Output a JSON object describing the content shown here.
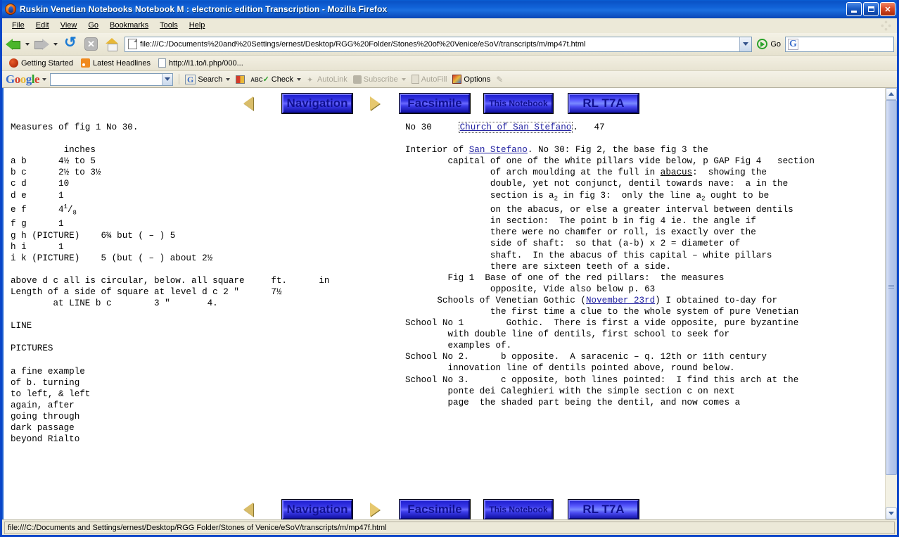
{
  "window": {
    "title": "Ruskin Venetian Notebooks Notebook M : electronic edition Transcription - Mozilla Firefox",
    "minimize_label": "Minimize",
    "maximize_label": "Maximize",
    "close_label": "Close"
  },
  "menubar": {
    "items": [
      {
        "label": "File"
      },
      {
        "label": "Edit"
      },
      {
        "label": "View"
      },
      {
        "label": "Go"
      },
      {
        "label": "Bookmarks"
      },
      {
        "label": "Tools"
      },
      {
        "label": "Help"
      }
    ]
  },
  "navtoolbar": {
    "back_label": "Back",
    "forward_label": "Forward",
    "reload_label": "Reload",
    "stop_label": "Stop",
    "stop_glyph": "✕",
    "home_label": "Home",
    "url": "file:///C:/Documents%20and%20Settings/ernest/Desktop/RGG%20Folder/Stones%20of%20Venice/eSoV/transcripts/m/mp47t.html",
    "url_placeholder": "",
    "go_label": "Go",
    "search_value": "",
    "search_placeholder": ""
  },
  "bookmarks": {
    "items": [
      {
        "label": "Getting Started",
        "icon": "firefox-icon"
      },
      {
        "label": "Latest Headlines",
        "icon": "rss-icon"
      },
      {
        "label": "http://i1.to/i.php/000...",
        "icon": "page-icon"
      }
    ]
  },
  "google_toolbar": {
    "logo": "Google",
    "search_value": "",
    "search_placeholder": "",
    "items": [
      {
        "label": "Search",
        "icon": "google-g-icon",
        "enabled": true,
        "caret": true
      },
      {
        "label": "",
        "icon": "bookmarks-icon",
        "enabled": true,
        "caret": false
      },
      {
        "label": "Check",
        "icon": "spellcheck-icon",
        "enabled": true,
        "caret": true
      },
      {
        "label": "AutoLink",
        "icon": "wand-icon",
        "enabled": false,
        "caret": false
      },
      {
        "label": "Subscribe",
        "icon": "rss-icon",
        "enabled": false,
        "caret": true
      },
      {
        "label": "AutoFill",
        "icon": "autofill-icon",
        "enabled": false,
        "caret": false
      },
      {
        "label": "Options",
        "icon": "options-icon",
        "enabled": true,
        "caret": false
      },
      {
        "label": "",
        "icon": "highlighter-icon",
        "enabled": false,
        "caret": false
      }
    ]
  },
  "page": {
    "nav": {
      "prev_arrow": "left-arrow-icon",
      "next_arrow": "right-arrow-icon",
      "navigation_label": "Navigation",
      "facsimile_label": "Facsimile",
      "notebook_label": "This Notebook",
      "rlt7a_label": "RL T7A"
    },
    "left_column": {
      "heading": "Measures of fig 1 No 30.",
      "unit_header": "          inches",
      "rows": [
        "a b      4½ to 5",
        "b c      2½ to 3½",
        "c d      10",
        "d e      1",
        "f g      1",
        "g h (PICTURE)    6¾ but ( – ) 5",
        "h i      1",
        "i k (PICTURE)    5 (but ( – ) about 2½"
      ],
      "ef_prefix": "e f      4",
      "ef_sup": "1",
      "ef_slash": "/",
      "ef_sub": "8",
      "note_lines": [
        "above d c all is circular, below. all square     ft.      in",
        "Length of a side of square at level d c 2 \"      7½",
        "        at LINE b c        3 \"       4."
      ],
      "line_heading": "LINE",
      "pictures_heading": "PICTURES",
      "caption_lines": [
        "a fine example",
        "of b. turning",
        "to left, & left",
        "again, after",
        "going through",
        "dark passage",
        "beyond Rialto"
      ]
    },
    "right_column": {
      "header_no": "No 30",
      "header_link": "Church of San Stefano",
      "header_link_part1": "Church of ",
      "header_link_part2": "San Stefano",
      "header_period": ".   47",
      "para1_pre": "Interior of ",
      "para1_link": "San Stefano",
      "para1_post": ". No 30: Fig 2, the base fig 3 the",
      "line2": "        capital of one of the white pillars vide below, p GAP Fig 4   section",
      "line3_pre": "                of arch moulding at the full in ",
      "line3_gloss": "abacus",
      "line3_post": ":  showing the",
      "line4": "                double, yet not conjunct, dentil towards nave:  a in the",
      "line5_a": "                section is a",
      "line5_sub1": "2",
      "line5_b": " in fig 3:  only the line a",
      "line5_sub2": "2",
      "line5_c": " ought to be",
      "line6": "                on the abacus, or else a greater interval between dentils",
      "line7": "                in section:  The point b in fig 4 ie. the angle if",
      "line8": "                there were no chamfer or roll, is exactly over the",
      "line9": "                side of shaft:  so that (a-b) x 2 = diameter of",
      "line10": "                shaft.  In the abacus of this capital – white pillars",
      "line11": "                there are sixteen teeth of a side.",
      "line12": "        Fig 1  Base of one of the red pillars:  the measures",
      "line13": "                opposite, Vide also below p. 63",
      "line14_pre": "      Schools of Venetian Gothic (",
      "line14_link": "November 23rd",
      "line14_post": ") I obtained to-day for",
      "line15": "                the first time a clue to the whole system of pure Venetian",
      "line16": "School No 1        Gothic.  There is first a vide opposite, pure byzantine",
      "line17": "        with double line of dentils, first school to seek for",
      "line18": "        examples of.",
      "line19": "School No 2.      b opposite.  A saracenic – q. 12th or 11th century",
      "line20": "        innovation line of dentils pointed above, round below.",
      "line21": "School No 3.      c opposite, both lines pointed:  I find this arch at the",
      "line22": "        ponte dei Caleghieri with the simple section c on next",
      "line23": "        page  the shaded part being the dentil, and now comes a"
    }
  },
  "scrollbar": {
    "up_label": "Scroll up",
    "down_label": "Scroll down",
    "thumb_label": "Scroll thumb"
  },
  "statusbar": {
    "text": "file:///C:/Documents and Settings/ernest/Desktop/RGG Folder/Stones of Venice/eSoV/transcripts/m/mp47f.html"
  },
  "colors": {
    "titlebar_blue": "#0a52c6",
    "chrome_beige": "#ece9d8",
    "link_blue": "#2020a0",
    "button_blue": "#3a3ae8",
    "gold_arrow": "#d9bd6a"
  }
}
